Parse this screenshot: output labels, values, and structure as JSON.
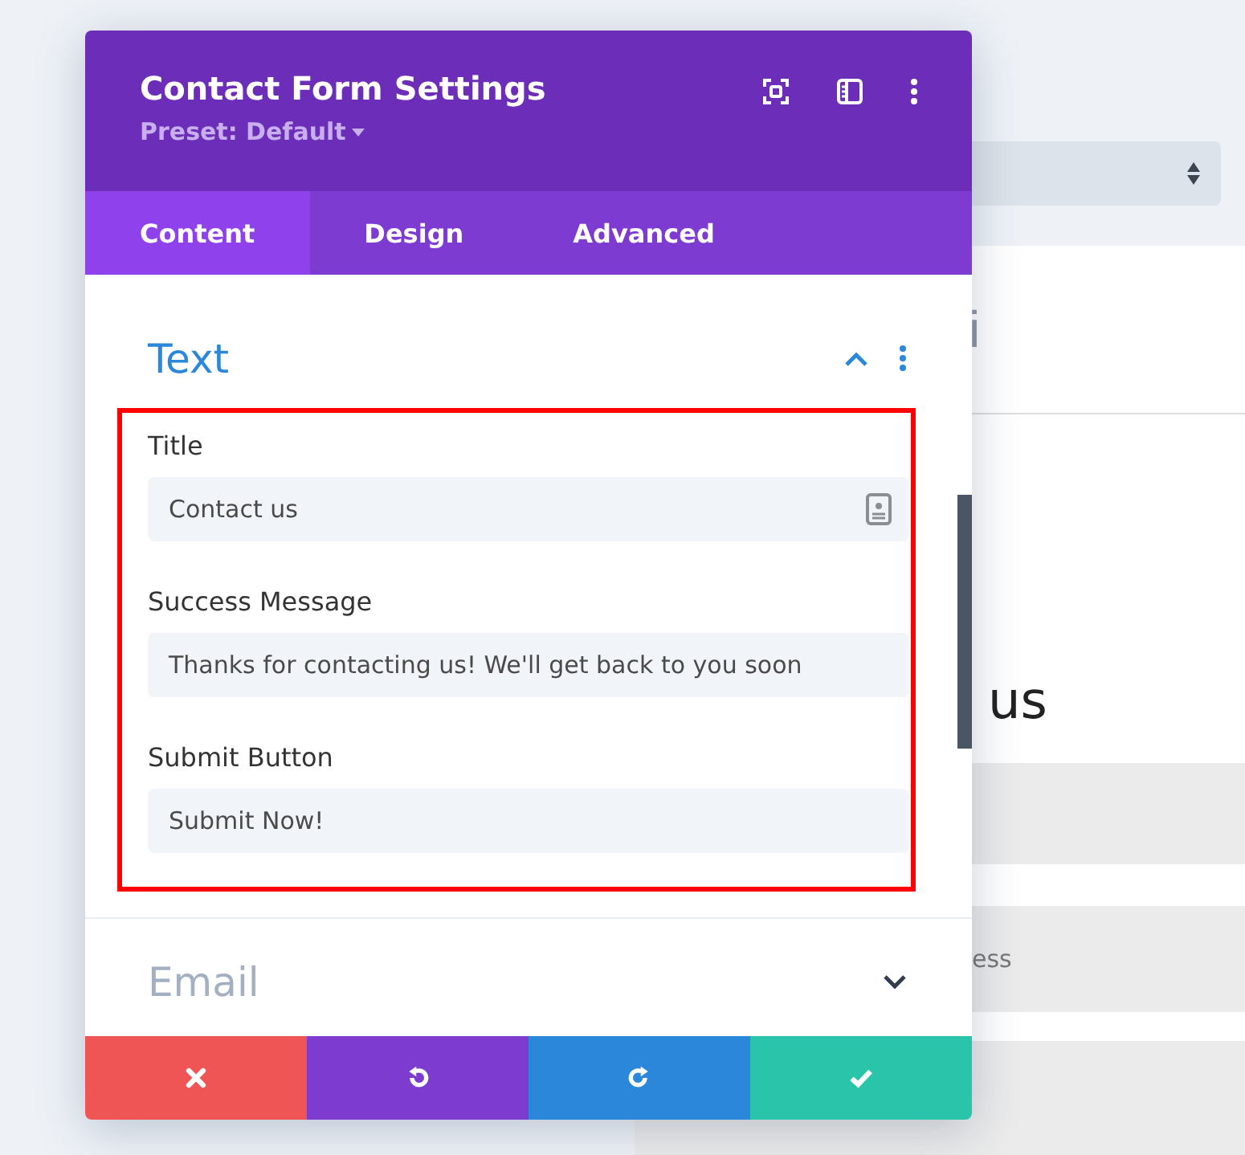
{
  "panel": {
    "title": "Contact Form Settings",
    "preset": "Preset: Default"
  },
  "tabs": [
    {
      "label": "Content",
      "selected": true
    },
    {
      "label": "Design",
      "selected": false
    },
    {
      "label": "Advanced",
      "selected": false
    }
  ],
  "sections": [
    {
      "title": "Text",
      "expanded": true,
      "fields": [
        {
          "label": "Title",
          "value": "Contact us",
          "dynamic": true
        },
        {
          "label": "Success Message",
          "value": "Thanks for contacting us! We'll get back to you soon",
          "dynamic": false
        },
        {
          "label": "Submit Button",
          "value": "Submit Now!",
          "dynamic": false
        }
      ]
    },
    {
      "title": "Email",
      "expanded": false
    }
  ],
  "actions": [
    {
      "kind": "discard"
    },
    {
      "kind": "undo"
    },
    {
      "kind": "redo"
    },
    {
      "kind": "save"
    }
  ],
  "background": {
    "heading": "i",
    "title": "us",
    "field": "ess"
  }
}
